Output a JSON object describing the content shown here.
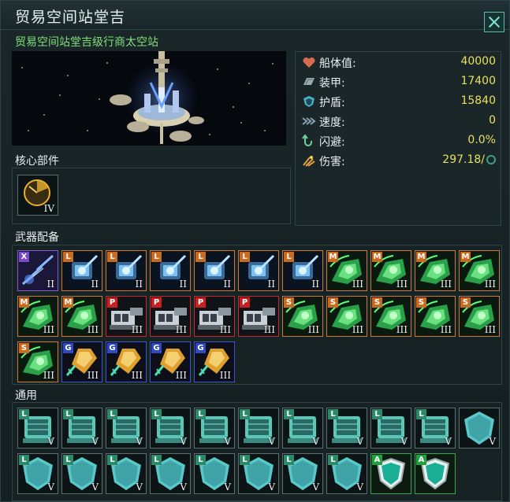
{
  "window": {
    "title": "贸易空间站堂吉",
    "close_icon": "close-icon"
  },
  "ship": {
    "subtitle": "贸易空间站堂吉级行商太空站"
  },
  "stats": [
    {
      "key": "hull",
      "label": "船体值:",
      "value": "40000",
      "icon": "heart-icon",
      "color": "#d86a50"
    },
    {
      "key": "armor",
      "label": "装甲:",
      "value": "17400",
      "icon": "armor-plate-icon",
      "color": "#9aa8b0"
    },
    {
      "key": "shield",
      "label": "护盾:",
      "value": "15840",
      "icon": "shield-icon",
      "color": "#4ab0c8"
    },
    {
      "key": "speed",
      "label": "速度:",
      "value": "0",
      "icon": "speed-arrows-icon",
      "color": "#8aa0b8"
    },
    {
      "key": "evasion",
      "label": "闪避:",
      "value": "0.0%",
      "icon": "evasion-arrow-icon",
      "color": "#6ad0a0"
    },
    {
      "key": "damage",
      "label": "伤害:",
      "value": "297.18/",
      "icon": "damage-burst-icon",
      "color": "#e8a040"
    }
  ],
  "core": {
    "label": "核心部件",
    "slots": [
      {
        "tier": "IV",
        "icon": "radar-core-icon"
      }
    ]
  },
  "weapons": {
    "label": "武器配备",
    "slots": [
      {
        "letter": "X",
        "tier": "II",
        "icon": "lightning-lance-icon"
      },
      {
        "letter": "L",
        "tier": "II",
        "icon": "laser-turret-icon"
      },
      {
        "letter": "L",
        "tier": "II",
        "icon": "laser-turret-icon"
      },
      {
        "letter": "L",
        "tier": "II",
        "icon": "laser-turret-icon"
      },
      {
        "letter": "L",
        "tier": "II",
        "icon": "laser-turret-icon"
      },
      {
        "letter": "L",
        "tier": "II",
        "icon": "laser-turret-icon"
      },
      {
        "letter": "L",
        "tier": "II",
        "icon": "laser-turret-icon"
      },
      {
        "letter": "M",
        "tier": "III",
        "icon": "missile-launcher-icon"
      },
      {
        "letter": "M",
        "tier": "III",
        "icon": "missile-launcher-icon"
      },
      {
        "letter": "M",
        "tier": "III",
        "icon": "missile-launcher-icon"
      },
      {
        "letter": "M",
        "tier": "III",
        "icon": "missile-launcher-icon"
      },
      {
        "letter": "M",
        "tier": "III",
        "icon": "missile-launcher-icon"
      },
      {
        "letter": "M",
        "tier": "III",
        "icon": "missile-launcher-icon"
      },
      {
        "letter": "P",
        "tier": "III",
        "icon": "plasma-cannon-icon"
      },
      {
        "letter": "P",
        "tier": "III",
        "icon": "plasma-cannon-icon"
      },
      {
        "letter": "P",
        "tier": "III",
        "icon": "plasma-cannon-icon"
      },
      {
        "letter": "P",
        "tier": "III",
        "icon": "plasma-cannon-icon"
      },
      {
        "letter": "S",
        "tier": "III",
        "icon": "missile-launcher-icon"
      },
      {
        "letter": "S",
        "tier": "III",
        "icon": "missile-launcher-icon"
      },
      {
        "letter": "S",
        "tier": "III",
        "icon": "missile-launcher-icon"
      },
      {
        "letter": "S",
        "tier": "III",
        "icon": "missile-launcher-icon"
      },
      {
        "letter": "S",
        "tier": "III",
        "icon": "missile-launcher-icon"
      },
      {
        "letter": "S",
        "tier": "III",
        "icon": "missile-launcher-icon"
      },
      {
        "letter": "G",
        "tier": "III",
        "icon": "mass-driver-icon"
      },
      {
        "letter": "G",
        "tier": "III",
        "icon": "mass-driver-icon"
      },
      {
        "letter": "G",
        "tier": "III",
        "icon": "mass-driver-icon"
      },
      {
        "letter": "G",
        "tier": "III",
        "icon": "mass-driver-icon"
      }
    ]
  },
  "utility": {
    "label": "通用",
    "slots": [
      {
        "letter": "L",
        "tier": "V",
        "icon": "armor-module-icon"
      },
      {
        "letter": "L",
        "tier": "V",
        "icon": "armor-module-icon"
      },
      {
        "letter": "L",
        "tier": "V",
        "icon": "armor-module-icon"
      },
      {
        "letter": "L",
        "tier": "V",
        "icon": "armor-module-icon"
      },
      {
        "letter": "L",
        "tier": "V",
        "icon": "armor-module-icon"
      },
      {
        "letter": "L",
        "tier": "V",
        "icon": "armor-module-icon"
      },
      {
        "letter": "L",
        "tier": "V",
        "icon": "armor-module-icon"
      },
      {
        "letter": "L",
        "tier": "V",
        "icon": "armor-module-icon"
      },
      {
        "letter": "L",
        "tier": "V",
        "icon": "armor-module-icon"
      },
      {
        "letter": "L",
        "tier": "V",
        "icon": "armor-module-icon"
      },
      {
        "letter": "",
        "tier": "V",
        "icon": "shield-generator-icon"
      },
      {
        "letter": "L",
        "tier": "V",
        "icon": "shield-generator-icon"
      },
      {
        "letter": "L",
        "tier": "V",
        "icon": "shield-generator-icon"
      },
      {
        "letter": "L",
        "tier": "V",
        "icon": "shield-generator-icon"
      },
      {
        "letter": "L",
        "tier": "V",
        "icon": "shield-generator-icon"
      },
      {
        "letter": "L",
        "tier": "V",
        "icon": "shield-generator-icon"
      },
      {
        "letter": "L",
        "tier": "V",
        "icon": "shield-generator-icon"
      },
      {
        "letter": "L",
        "tier": "V",
        "icon": "shield-generator-icon"
      },
      {
        "letter": "L",
        "tier": "V",
        "icon": "shield-generator-icon"
      },
      {
        "letter": "A",
        "tier": "",
        "icon": "aux-shield-emblem-icon"
      },
      {
        "letter": "A",
        "tier": "",
        "icon": "aux-shield-emblem-icon"
      }
    ]
  },
  "colors": {
    "accent_green": "#7fe07a",
    "value_yellow": "#e8e060",
    "panel_border": "#2f4345"
  }
}
